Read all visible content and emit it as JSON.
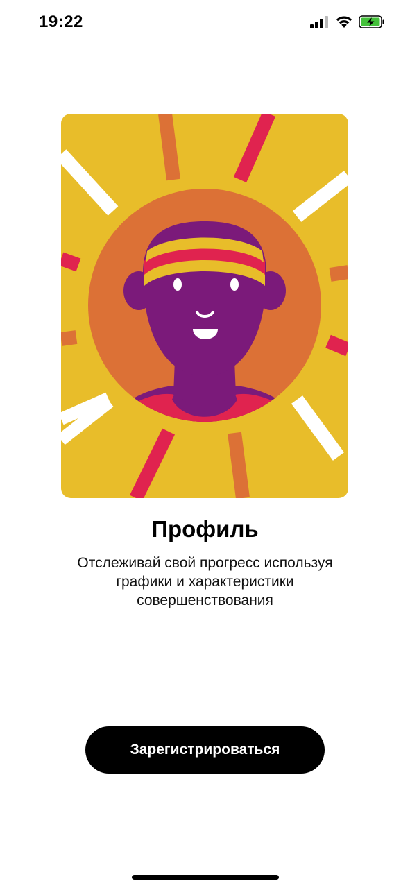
{
  "status_bar": {
    "time": "19:22",
    "icons": [
      "cellular-signal-icon",
      "wifi-icon",
      "battery-charging-icon"
    ]
  },
  "illustration": {
    "subject": "person-avatar-sun-illustration",
    "colors": {
      "background": "#E8BD2A",
      "circle": "#DC7136",
      "figure": "#7B1A7A",
      "headband_red": "#E0234F",
      "headband_yellow": "#E8BD2A",
      "ray_white": "#FFFFFF",
      "ray_red": "#E0234F",
      "ray_orange": "#DC7136"
    }
  },
  "content": {
    "title": "Профиль",
    "description": "Отслеживай свой прогресс используя графики и характеристики совершенствования"
  },
  "actions": {
    "register_label": "Зарегистрироваться"
  },
  "colors": {
    "button_bg": "#000000",
    "button_text": "#FFFFFF",
    "page_bg": "#FFFFFF"
  }
}
